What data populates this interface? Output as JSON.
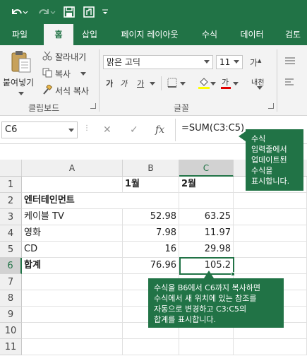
{
  "colors": {
    "accent": "#217346"
  },
  "tabs": [
    "파일",
    "홈",
    "삽입",
    "페이지 레이아웃",
    "수식",
    "데이터",
    "검토"
  ],
  "ribbon": {
    "paste": "붙여넣기",
    "cut": "잘라내기",
    "copy": "복사",
    "format_painter": "서식 복사",
    "group_clipboard": "클립보드",
    "font_name": "맑은 고딕",
    "font_size": "11",
    "bold": "가",
    "italic": "가",
    "underline": "가",
    "font_color_glyph": "가",
    "phonetic": "내천",
    "group_font": "글꼴"
  },
  "formula_bar": {
    "name_box": "C6",
    "cancel": "✕",
    "enter": "✓",
    "fx": "fx",
    "formula": "=SUM(C3:C5)"
  },
  "grid": {
    "columns": [
      "A",
      "B",
      "C"
    ],
    "rows": [
      {
        "num": "1",
        "a": "",
        "b": "1월",
        "c": "2월"
      },
      {
        "num": "2",
        "a": "엔터테인먼트",
        "b": "",
        "c": ""
      },
      {
        "num": "3",
        "a": "케이블 TV",
        "b": "52.98",
        "c": "63.25"
      },
      {
        "num": "4",
        "a": "영화",
        "b": "7.98",
        "c": "11.97"
      },
      {
        "num": "5",
        "a": "CD",
        "b": "16",
        "c": "29.98"
      },
      {
        "num": "6",
        "a": "합계",
        "b": "76.96",
        "c": "105.2"
      },
      {
        "num": "7",
        "a": "",
        "b": "",
        "c": ""
      },
      {
        "num": "8",
        "a": "",
        "b": "",
        "c": ""
      },
      {
        "num": "9",
        "a": "",
        "b": "",
        "c": ""
      },
      {
        "num": "10",
        "a": "",
        "b": "",
        "c": ""
      },
      {
        "num": "11",
        "a": "",
        "b": "",
        "c": ""
      }
    ]
  },
  "callouts": {
    "top": [
      "수식",
      "입력줄에서",
      "업데이트된",
      "수식을",
      "표시합니다."
    ],
    "bottom": [
      "수식을 B6에서 C6까지 복사하면",
      "수식에서 새 위치에 있는 참조를",
      "자동으로 변경하고 C3:C5의",
      "합계를 표시합니다."
    ]
  }
}
